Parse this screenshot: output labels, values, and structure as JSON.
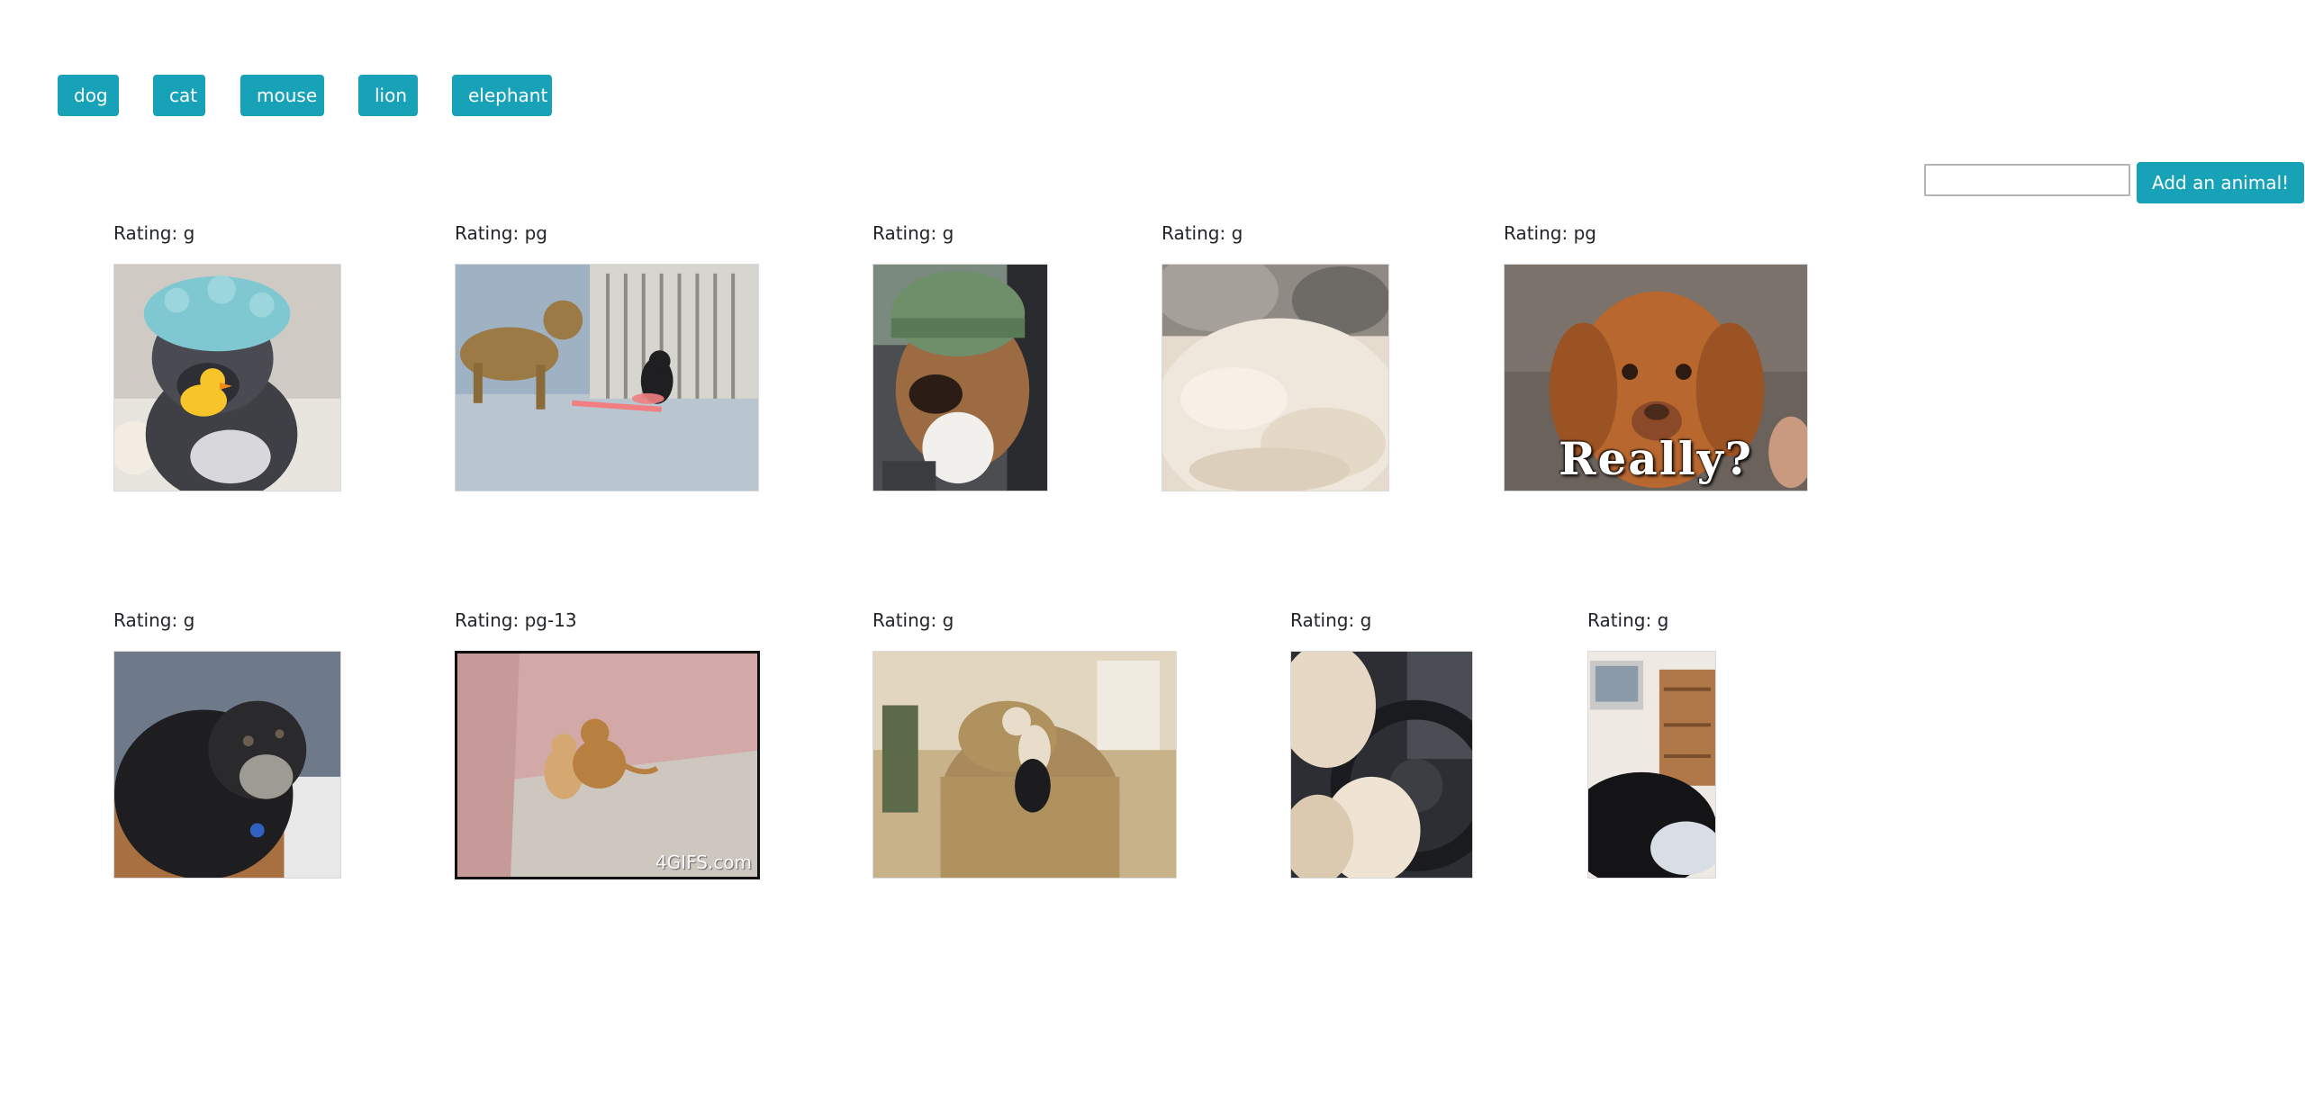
{
  "topic_buttons": [
    {
      "label": "dog"
    },
    {
      "label": "cat"
    },
    {
      "label": "mouse"
    },
    {
      "label": "lion"
    },
    {
      "label": "elephant"
    }
  ],
  "add_form": {
    "input_value": "",
    "input_placeholder": "",
    "button_label": "Add an animal!"
  },
  "gifs": [
    {
      "rating": "Rating: g",
      "content": "dog in shower cap holding rubber duck"
    },
    {
      "rating": "Rating: pg",
      "content": "dog and cat chasing laser pointer"
    },
    {
      "rating": "Rating: g",
      "content": "dog wearing green knit beanie"
    },
    {
      "rating": "Rating: g",
      "content": "fluffy white fur rug"
    },
    {
      "rating": "Rating: pg",
      "content": "puppy with caption",
      "caption": "Really?"
    },
    {
      "rating": "Rating: g",
      "content": "black dog lying down"
    },
    {
      "rating": "Rating: pg-13",
      "content": "two small dogs wrestling",
      "watermark": "4GIFS.com"
    },
    {
      "rating": "Rating: g",
      "content": "dog standing on armchair"
    },
    {
      "rating": "Rating: g",
      "content": "dog paws on steering wheel"
    },
    {
      "rating": "Rating: g",
      "content": "black cat in room"
    }
  ],
  "colors": {
    "accent": "#17a2b8",
    "text": "#212529"
  }
}
